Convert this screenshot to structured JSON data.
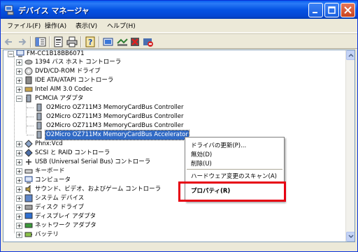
{
  "window": {
    "title": "デバイス マネージャ"
  },
  "menubar": {
    "items": [
      "ファイル(F)",
      "操作(A)",
      "表示(V)",
      "ヘルプ(H)"
    ]
  },
  "tree": {
    "root": "FM-CC1B18BB6071",
    "nodes": [
      {
        "label": "1394 バス ホスト コントローラ",
        "icon": "bus-icon",
        "expanded": false
      },
      {
        "label": "DVD/CD-ROM ドライブ",
        "icon": "cdrom-icon",
        "expanded": false
      },
      {
        "label": "IDE ATA/ATAPI コントローラ",
        "icon": "ide-icon",
        "expanded": false
      },
      {
        "label": "Intel AIM 3.0 Codec",
        "icon": "codec-icon",
        "expanded": false
      },
      {
        "label": "PCMCIA アダプタ",
        "icon": "pcmcia-icon",
        "expanded": true
      },
      {
        "label": "Phnx:Vcd",
        "icon": "device-icon",
        "expanded": false
      },
      {
        "label": "SCSI と RAID コントローラ",
        "icon": "scsi-icon",
        "expanded": false
      },
      {
        "label": "USB (Universal Serial Bus) コントローラ",
        "icon": "usb-icon",
        "expanded": false
      },
      {
        "label": "キーボード",
        "icon": "keyboard-icon",
        "expanded": false
      },
      {
        "label": "コンピュータ",
        "icon": "computer-icon",
        "expanded": false
      },
      {
        "label": "サウンド、ビデオ、およびゲーム コントローラ",
        "icon": "sound-icon",
        "expanded": false
      },
      {
        "label": "システム デバイス",
        "icon": "system-icon",
        "expanded": false
      },
      {
        "label": "ディスク ドライブ",
        "icon": "disk-icon",
        "expanded": false
      },
      {
        "label": "ディスプレイ アダプタ",
        "icon": "display-icon",
        "expanded": false
      },
      {
        "label": "ネットワーク アダプタ",
        "icon": "network-icon",
        "expanded": false
      },
      {
        "label": "バッテリ",
        "icon": "battery-icon",
        "expanded": false
      }
    ],
    "pcmcia_children": [
      "O2Micro OZ711M3 MemoryCardBus Controller",
      "O2Micro OZ711M3 MemoryCardBus Controller",
      "O2Micro OZ711M3 MemoryCardBus Controller",
      "O2Micro OZ711Mx MemoryCardBus Accelerator"
    ],
    "selected_child_index": 3
  },
  "context_menu": {
    "items": [
      "ドライバの更新(P)...",
      "無効(D)",
      "削除(U)",
      "ハードウェア変更のスキャン(A)",
      "プロパティ(R)"
    ],
    "highlighted": "プロパティ(R)"
  },
  "colors": {
    "titlebar": "#0553e3",
    "selection": "#316ac5",
    "highlight_box": "#e60012"
  }
}
